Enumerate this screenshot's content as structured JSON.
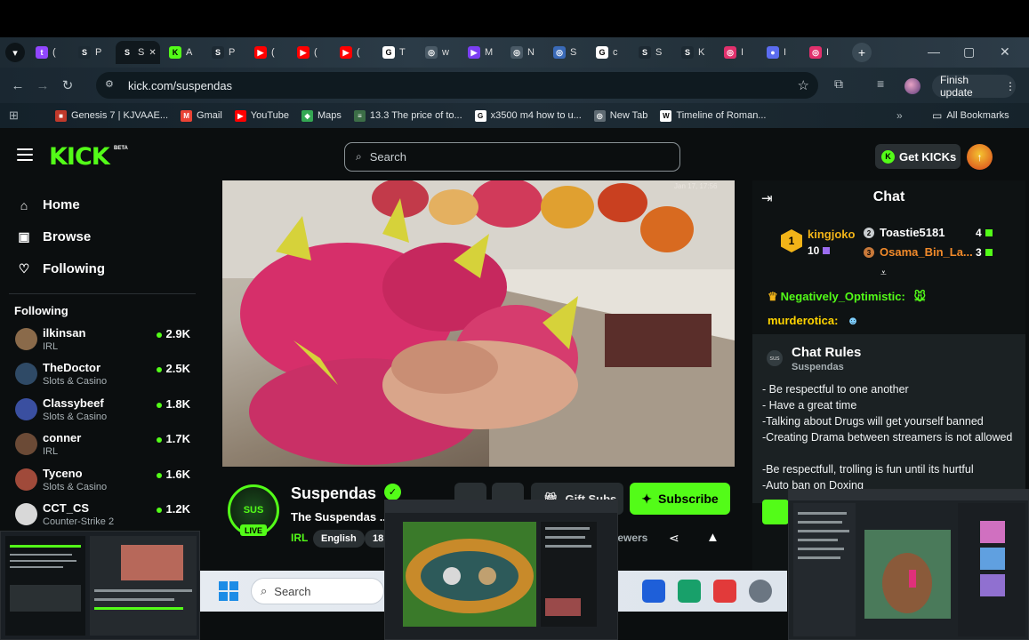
{
  "browser": {
    "active_tab_label": "S",
    "tabs": [
      {
        "icon": "twitch-icon",
        "label": "(",
        "color": "#9146ff",
        "glyph": "t"
      },
      {
        "icon": "s-logo-icon",
        "label": "P",
        "color": "#1d2a33",
        "glyph": "S"
      },
      {
        "icon": "s-logo-icon",
        "label": "S",
        "color": "#10181d",
        "glyph": "S",
        "active": true
      },
      {
        "icon": "kick-icon",
        "label": "A",
        "color": "#53fc18",
        "glyph": "K"
      },
      {
        "icon": "s-logo-icon",
        "label": "P",
        "color": "#1d2a33",
        "glyph": "S"
      },
      {
        "icon": "youtube-icon",
        "label": "(",
        "color": "#ff0000",
        "glyph": "▶"
      },
      {
        "icon": "youtube-icon",
        "label": "(",
        "color": "#ff0000",
        "glyph": "▶"
      },
      {
        "icon": "youtube-icon",
        "label": "(",
        "color": "#ff0000",
        "glyph": "▶"
      },
      {
        "icon": "google-icon",
        "label": "T",
        "color": "#ffffff",
        "glyph": "G"
      },
      {
        "icon": "globe-icon",
        "label": "w",
        "color": "#4a5a66",
        "glyph": "◎"
      },
      {
        "icon": "play-icon",
        "label": "M",
        "color": "#7b3ff2",
        "glyph": "▶"
      },
      {
        "icon": "globe-icon",
        "label": "N",
        "color": "#4a5a66",
        "glyph": "◎"
      },
      {
        "icon": "globe-icon",
        "label": "S",
        "color": "#3a6ab8",
        "glyph": "◎"
      },
      {
        "icon": "google-icon",
        "label": "c",
        "color": "#ffffff",
        "glyph": "G"
      },
      {
        "icon": "s-logo-icon",
        "label": "S",
        "color": "#1d2a33",
        "glyph": "S"
      },
      {
        "icon": "s-logo-icon",
        "label": "K",
        "color": "#1d2a33",
        "glyph": "S"
      },
      {
        "icon": "instagram-icon",
        "label": "I",
        "color": "#e1306c",
        "glyph": "◎"
      },
      {
        "icon": "record-icon",
        "label": "I",
        "color": "#5b6cf0",
        "glyph": "●"
      },
      {
        "icon": "instagram-icon",
        "label": "I",
        "color": "#e1306c",
        "glyph": "◎"
      }
    ],
    "url": "kick.com/suspendas",
    "finish_update": "Finish update",
    "bookmarks": [
      {
        "label": "Genesis 7 | KJVAAE...",
        "icon": "bookmark-genesis-icon",
        "color": "#c0392b",
        "glyph": "■"
      },
      {
        "label": "Gmail",
        "icon": "gmail-icon",
        "color": "#ea4335",
        "glyph": "M"
      },
      {
        "label": "YouTube",
        "icon": "youtube-icon",
        "color": "#ff0000",
        "glyph": "▶"
      },
      {
        "label": "Maps",
        "icon": "maps-icon",
        "color": "#34a853",
        "glyph": "◆"
      },
      {
        "label": "13.3 The price of to...",
        "icon": "book-icon",
        "color": "#3c6e47",
        "glyph": "≡"
      },
      {
        "label": "x3500 m4 how to u...",
        "icon": "google-icon",
        "color": "#ffffff",
        "glyph": "G"
      },
      {
        "label": "New Tab",
        "icon": "globe-icon",
        "color": "#5f6b73",
        "glyph": "◎"
      },
      {
        "label": "Timeline of Roman...",
        "icon": "wikipedia-icon",
        "color": "#ffffff",
        "glyph": "W"
      }
    ],
    "all_bookmarks": "All Bookmarks"
  },
  "kick": {
    "logo": "KICK",
    "beta": "BETA",
    "search_placeholder": "Search",
    "get_kicks": "Get KICKs",
    "nav": [
      {
        "label": "Home",
        "icon": "home-icon",
        "glyph": "⌂"
      },
      {
        "label": "Browse",
        "icon": "browse-icon",
        "glyph": "▣"
      },
      {
        "label": "Following",
        "icon": "heart-icon",
        "glyph": "♡"
      }
    ],
    "following_title": "Following",
    "following": [
      {
        "name": "ilkinsan",
        "category": "IRL",
        "viewers": "2.9K",
        "avatar_color": "#8a6a4a"
      },
      {
        "name": "TheDoctor",
        "category": "Slots & Casino",
        "viewers": "2.5K",
        "avatar_color": "#2f4a66"
      },
      {
        "name": "Classybeef",
        "category": "Slots & Casino",
        "viewers": "1.8K",
        "avatar_color": "#3a4fa0"
      },
      {
        "name": "conner",
        "category": "IRL",
        "viewers": "1.7K",
        "avatar_color": "#6b4a36"
      },
      {
        "name": "Tyceno",
        "category": "Slots & Casino",
        "viewers": "1.6K",
        "avatar_color": "#a04a3a"
      },
      {
        "name": "CCT_CS",
        "category": "Counter-Strike 2",
        "viewers": "1.2K",
        "avatar_color": "#d8d8d8"
      }
    ],
    "stream": {
      "timestamp": "Jan 17, 17:56",
      "streamer": "Suspendas",
      "avatar_text": "SUS",
      "live": "LIVE",
      "title": "The Suspendas ...",
      "category": "IRL",
      "tags": [
        "English",
        "18"
      ],
      "subscribe": "Subscribe",
      "gift_subs": "Gift Subs",
      "viewers_label": "iewers"
    },
    "chat": {
      "title": "Chat",
      "top_gifters": [
        {
          "rank": "1",
          "name": "kingjoko",
          "count": "10"
        },
        {
          "rank": "2",
          "name": "Toastie5181",
          "count": "4"
        },
        {
          "rank": "3",
          "name": "Osama_Bin_La...",
          "count": "3"
        }
      ],
      "messages": [
        {
          "user": "Negatively_Optimistic:",
          "color": "#53fc18"
        },
        {
          "user": "murderotica:",
          "color": "#ffd400"
        }
      ],
      "rules_title": "Chat Rules",
      "rules_owner": "Suspendas",
      "rules": [
        "- Be respectful to one another",
        "- Have a great time",
        "-Talking about Drugs will get yourself banned",
        "-Creating Drama between streamers is not allowed",
        "-Be respectfull, trolling is fun until its hurtful",
        "-Auto ban on Doxing"
      ]
    }
  },
  "taskbar": {
    "search_placeholder": "Search"
  },
  "colors": {
    "kick_green": "#53fc18",
    "page_bg": "#0b0e0f",
    "panel": "#2a3033"
  }
}
